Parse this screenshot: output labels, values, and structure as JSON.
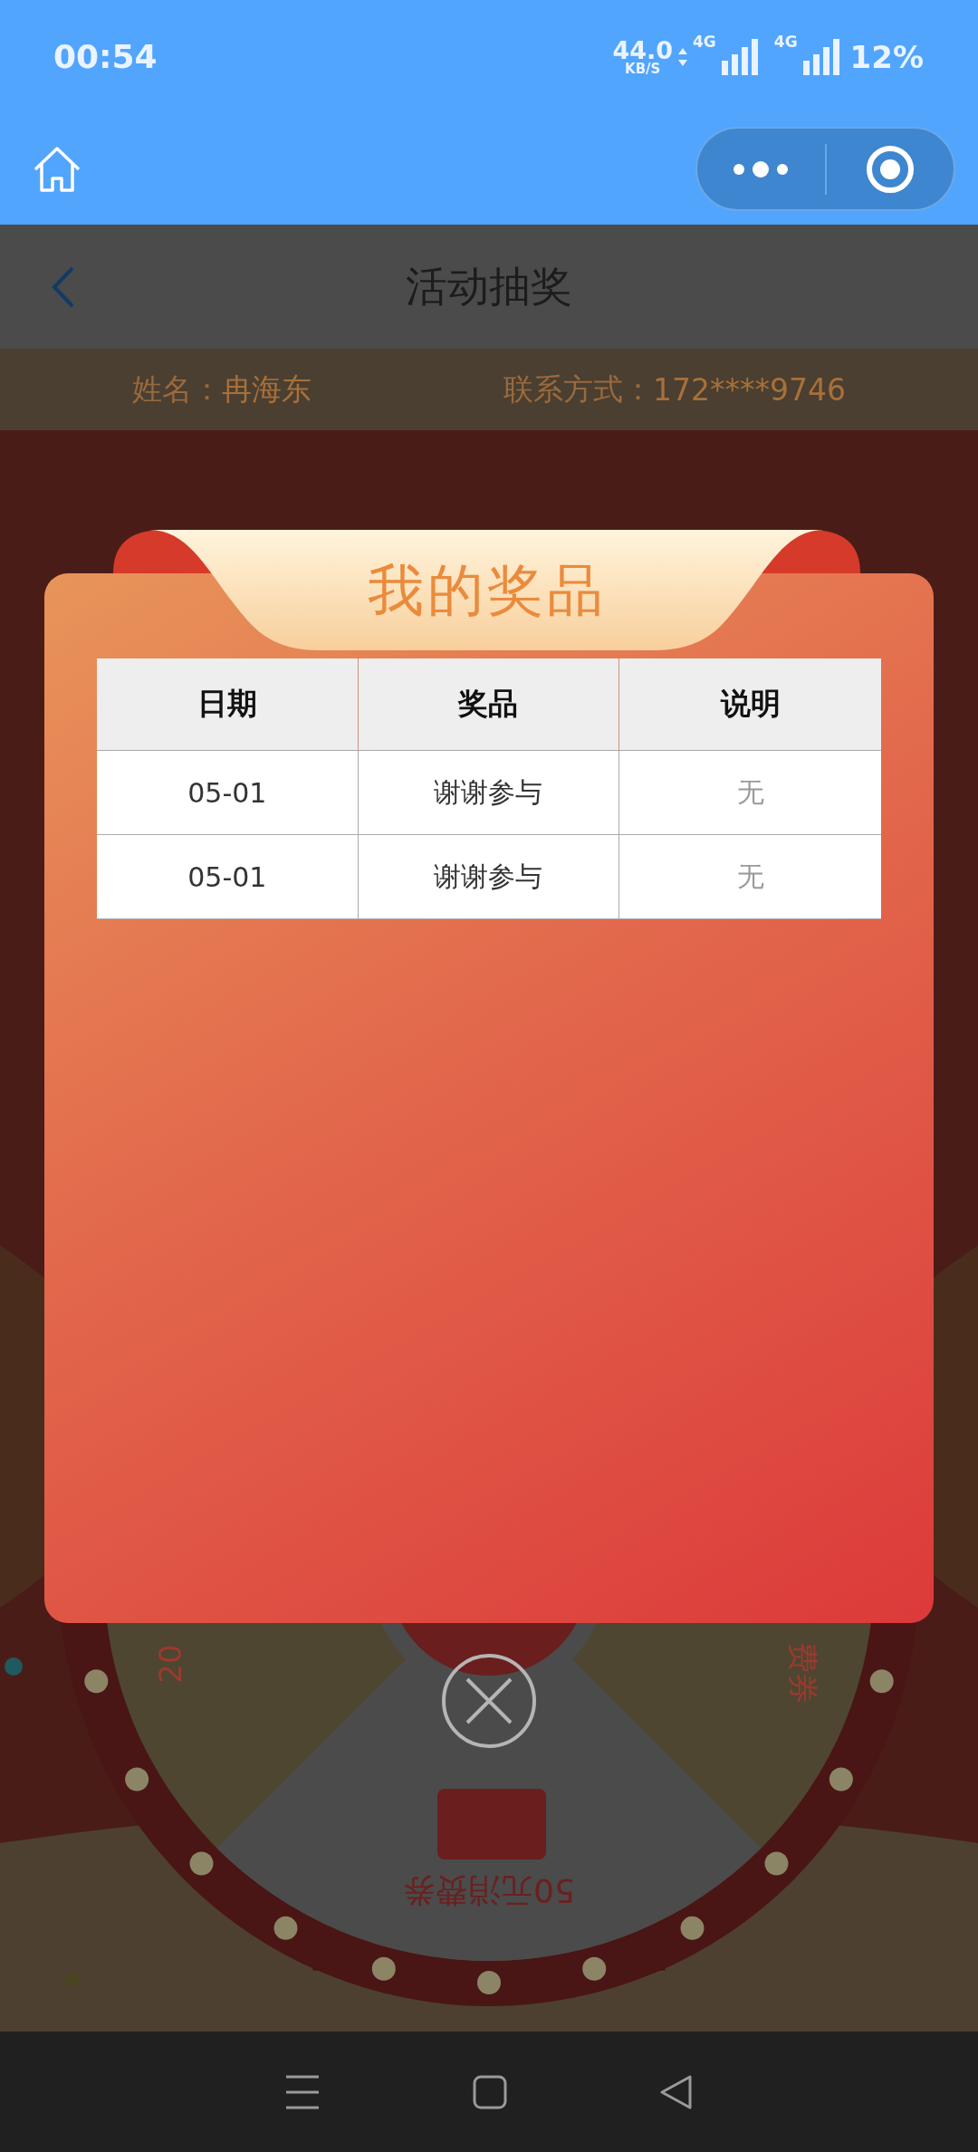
{
  "status_bar": {
    "time": "00:54",
    "net_speed": "44.0",
    "net_unit": "KB/S",
    "sim_1": "4G",
    "sim_2": "4G",
    "battery": "12%"
  },
  "page": {
    "title": "活动抽奖"
  },
  "user_info": {
    "name_label": "姓名：",
    "name": "冉海东",
    "contact_label": "联系方式：",
    "contact": "172****9746"
  },
  "wheel": {
    "labels": [
      {
        "text": "20",
        "kind": "left"
      },
      {
        "text": "费券",
        "kind": "right"
      },
      {
        "text": "50元消费券",
        "kind": "bottom"
      }
    ]
  },
  "modal": {
    "title": "我的奖品",
    "columns": [
      "日期",
      "奖品",
      "说明"
    ],
    "rows": [
      [
        "05-01",
        "谢谢参与",
        "无"
      ],
      [
        "05-01",
        "谢谢参与",
        "无"
      ]
    ]
  }
}
